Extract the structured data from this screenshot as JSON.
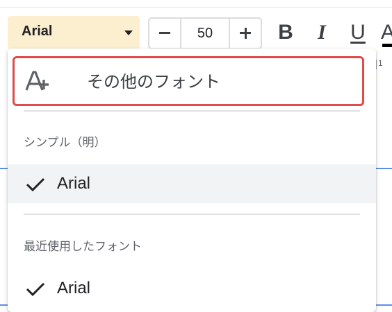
{
  "toolbar": {
    "font_name": "Arial",
    "font_size": "50",
    "bold_label": "B",
    "italic_label": "I",
    "underline_label": "U",
    "text_color_label": "A",
    "highlight_color": "#fcefcf"
  },
  "ruler": {
    "mark": "1"
  },
  "font_menu": {
    "more_fonts_label": "その他のフォント",
    "more_fonts_icon": "add-font-icon",
    "simple_section_label": "シンプル（明）",
    "simple_fonts": [
      {
        "label": "Arial",
        "checked": true
      }
    ],
    "recent_section_label": "最近使用したフォント",
    "recent_fonts": [
      {
        "label": "Arial",
        "checked": true
      }
    ],
    "highlight_border_color": "#e04b4b"
  }
}
